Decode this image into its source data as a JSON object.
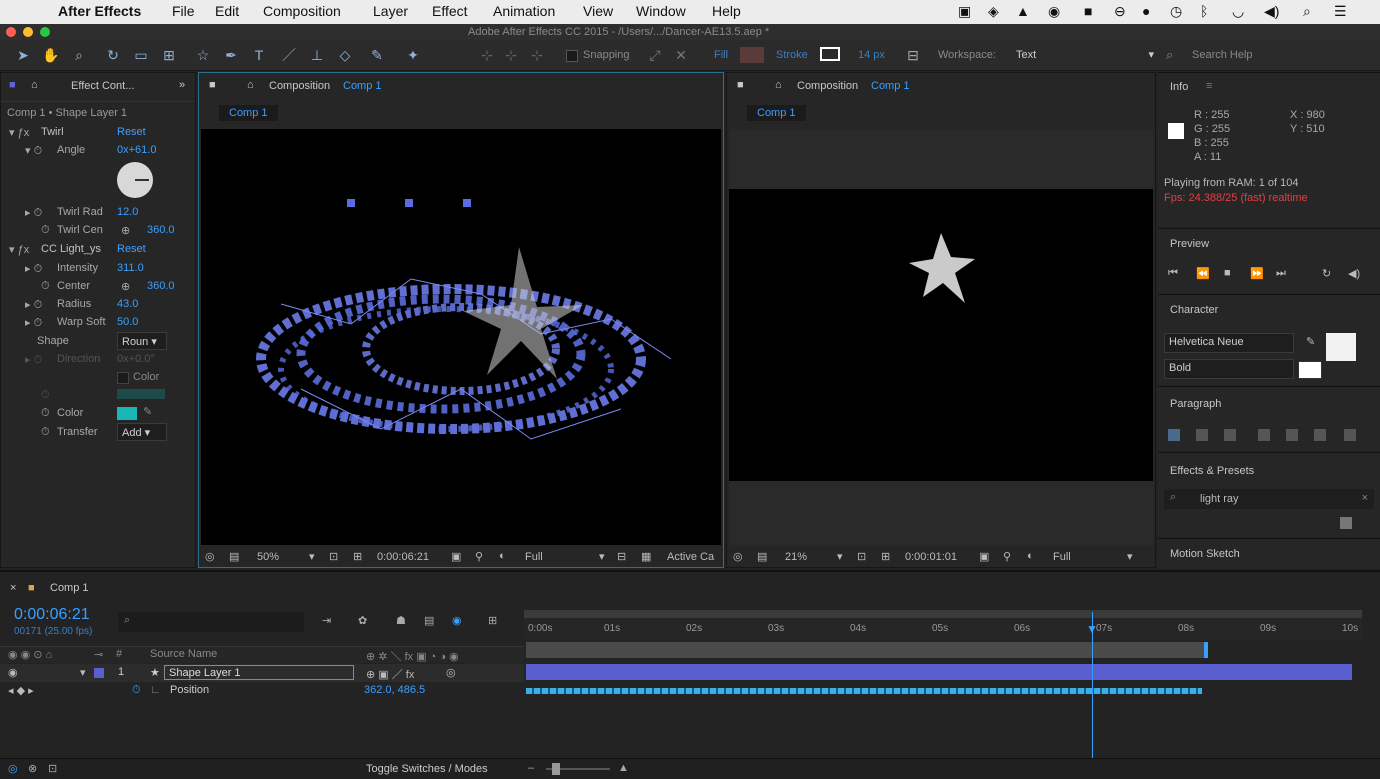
{
  "menubar": {
    "app_name": "After Effects",
    "items": [
      "File",
      "Edit",
      "Composition",
      "Layer",
      "Effect",
      "Animation",
      "View",
      "Window",
      "Help"
    ]
  },
  "titlebar": {
    "title": "Adobe After Effects CC 2015 - /Users/.../Dancer-AE13.5.aep *"
  },
  "toolbar": {
    "snapping_label": "Snapping",
    "fill_label": "Fill",
    "stroke_label": "Stroke",
    "stroke_width": "14 px",
    "workspace_label": "Workspace:",
    "workspace_value": "Text",
    "search_help_placeholder": "Search Help"
  },
  "effect_controls": {
    "tab_label": "Effect Cont...",
    "header": "Comp 1 • Shape Layer 1",
    "twirl_label": "Twirl",
    "twirl_reset": "Reset",
    "angle_label": "Angle",
    "angle_value": "0x+61.0",
    "twirl_radius_label": "Twirl Rad",
    "twirl_radius_value": "12.0",
    "twirl_center_label": "Twirl Cen",
    "twirl_center_value": "360.0",
    "cc_light_label": "CC Light_ys",
    "cc_light_reset": "Reset",
    "intensity_label": "Intensity",
    "intensity_value": "311.0",
    "center_label": "Center",
    "center_value": "360.0",
    "radius_label": "Radius",
    "radius_value": "43.0",
    "warp_label": "Warp Soft",
    "warp_value": "50.0",
    "shape_label": "Shape",
    "shape_value": "Roun",
    "direction_label": "Direction",
    "direction_value": "0x+0.0°",
    "color_from_label": "Color",
    "color_label": "Color",
    "transfer_label": "Transfer",
    "transfer_value": "Add"
  },
  "comp_left": {
    "tab_label": "Composition",
    "tab_name": "Comp 1",
    "subtab": "Comp 1",
    "zoom": "50%",
    "timecode": "0:00:06:21",
    "resolution": "Full",
    "view": "Active Ca"
  },
  "comp_right": {
    "tab_label": "Composition",
    "tab_name": "Comp 1",
    "subtab": "Comp 1",
    "zoom": "21%",
    "timecode": "0:00:01:01",
    "resolution": "Full"
  },
  "info": {
    "title": "Info",
    "r": "R : 255",
    "g": "G : 255",
    "b": "B : 255",
    "a": "A : 11",
    "x": "X : 980",
    "y": "Y : 510",
    "status1": "Playing from RAM: 1 of 104",
    "status2": "Fps: 24.388/25 (fast) realtime"
  },
  "preview": {
    "title": "Preview"
  },
  "character": {
    "title": "Character",
    "font": "Helvetica Neue",
    "style": "Bold"
  },
  "paragraph": {
    "title": "Paragraph"
  },
  "effects_presets": {
    "title": "Effects & Presets",
    "search_value": "light ray"
  },
  "motion_sketch": {
    "title": "Motion Sketch"
  },
  "timeline": {
    "tab_name": "Comp 1",
    "timecode": "0:00:06:21",
    "frame_info": "00171 (25.00 fps)",
    "col_source_name": "Source Name",
    "layer_number": "1",
    "layer_name": "Shape Layer 1",
    "property_name": "Position",
    "property_value": "362.0, 486.5",
    "ticks": [
      "0:00s",
      "01s",
      "02s",
      "03s",
      "04s",
      "05s",
      "06s",
      "07s",
      "08s",
      "09s",
      "10s"
    ],
    "toggle_label": "Toggle Switches / Modes"
  },
  "colors": {
    "accent": "#3aa0ff",
    "layer_bar": "#5a5fd0",
    "menubar_bg": "#ececec",
    "panel_bg": "#262626",
    "color_swatch": "#1ab5b5"
  }
}
